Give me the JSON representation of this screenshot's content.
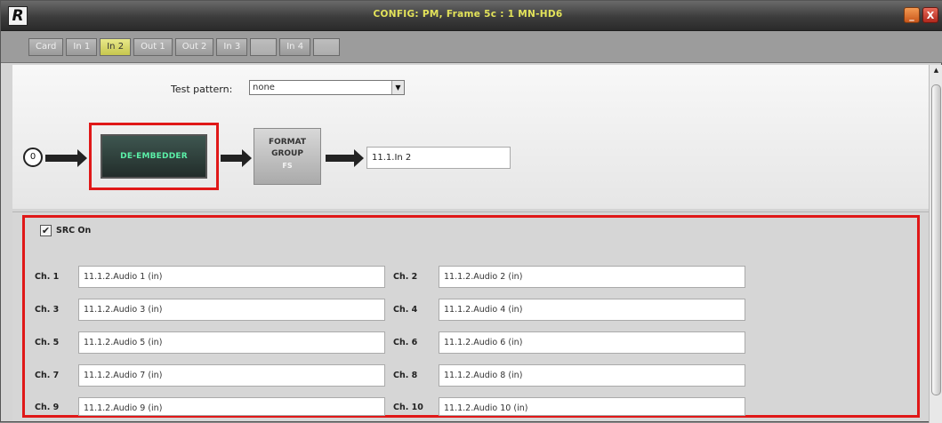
{
  "window": {
    "title": "CONFIG: PM, Frame 5c : 1 MN-HD6",
    "logo_letter": "R",
    "minimize_symbol": "_",
    "close_symbol": "X"
  },
  "tabs": [
    {
      "label": "Card",
      "state": "normal"
    },
    {
      "label": "In 1",
      "state": "normal"
    },
    {
      "label": "In 2",
      "state": "active"
    },
    {
      "label": "Out 1",
      "state": "normal"
    },
    {
      "label": "Out 2",
      "state": "normal"
    },
    {
      "label": "In 3",
      "state": "normal"
    },
    {
      "label": "",
      "state": "disabled"
    },
    {
      "label": "In 4",
      "state": "normal"
    },
    {
      "label": "",
      "state": "disabled"
    }
  ],
  "test_pattern": {
    "label": "Test pattern:",
    "value": "none",
    "arrow": "▼"
  },
  "flow": {
    "source_label": "0",
    "deembedder_label": "DE-EMBEDDER",
    "format_group_line1": "FORMAT",
    "format_group_line2": "GROUP",
    "format_group_sub": "FS",
    "output_value": "11.1.In 2"
  },
  "src": {
    "checkbox_mark": "✔",
    "label": "SRC On",
    "checked": true
  },
  "channels": [
    {
      "label": "Ch. 1",
      "value": "11.1.2.Audio 1 (in)"
    },
    {
      "label": "Ch. 2",
      "value": "11.1.2.Audio 2 (in)"
    },
    {
      "label": "Ch. 3",
      "value": "11.1.2.Audio 3 (in)"
    },
    {
      "label": "Ch. 4",
      "value": "11.1.2.Audio 4 (in)"
    },
    {
      "label": "Ch. 5",
      "value": "11.1.2.Audio 5 (in)"
    },
    {
      "label": "Ch. 6",
      "value": "11.1.2.Audio 6 (in)"
    },
    {
      "label": "Ch. 7",
      "value": "11.1.2.Audio 7 (in)"
    },
    {
      "label": "Ch. 8",
      "value": "11.1.2.Audio 8 (in)"
    },
    {
      "label": "Ch. 9",
      "value": "11.1.2.Audio 9 (in)"
    },
    {
      "label": "Ch. 10",
      "value": "11.1.2.Audio 10 (in)"
    }
  ],
  "scrollbar": {
    "up_arrow": "▲"
  },
  "colors": {
    "highlight": "#e01818",
    "active_tab": "#c6c64e",
    "title_text": "#e3e35a",
    "deembedder_text": "#5bf0a8"
  }
}
